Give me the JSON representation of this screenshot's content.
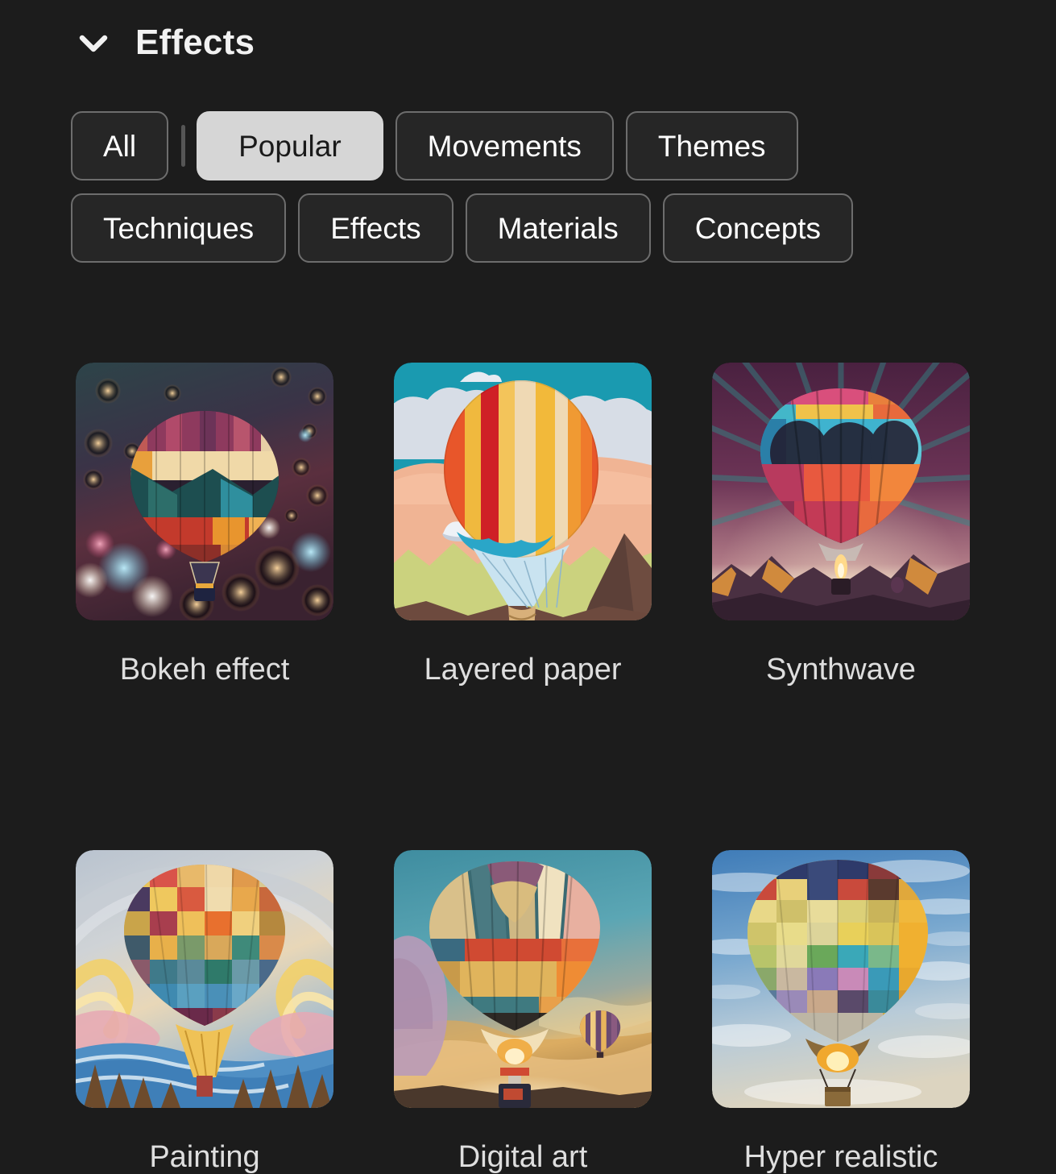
{
  "header": {
    "title": "Effects",
    "collapse_icon": "chevron-down-icon"
  },
  "filters": {
    "rows": [
      [
        {
          "label": "All",
          "selected": false
        },
        {
          "label": "Popular",
          "selected": true
        },
        {
          "label": "Movements",
          "selected": false
        },
        {
          "label": "Themes",
          "selected": false
        }
      ],
      [
        {
          "label": "Techniques",
          "selected": false
        },
        {
          "label": "Effects",
          "selected": false
        },
        {
          "label": "Materials",
          "selected": false
        },
        {
          "label": "Concepts",
          "selected": false
        }
      ]
    ]
  },
  "styles": {
    "items": [
      {
        "label": "Bokeh effect",
        "thumbnail": "hot-air-balloon-bokeh"
      },
      {
        "label": "Layered paper",
        "thumbnail": "hot-air-balloon-paper-craft"
      },
      {
        "label": "Synthwave",
        "thumbnail": "hot-air-balloon-synthwave"
      },
      {
        "label": "Painting",
        "thumbnail": "hot-air-balloon-impressionist-painting"
      },
      {
        "label": "Digital art",
        "thumbnail": "hot-air-balloon-digital-art"
      },
      {
        "label": "Hyper realistic",
        "thumbnail": "hot-air-balloon-photograph"
      }
    ]
  },
  "colors": {
    "background": "#1c1c1c",
    "chip_background": "#262626",
    "chip_border": "#6d6d6d",
    "chip_selected_background": "#d6d6d6",
    "chip_selected_text": "#1a1a1a",
    "text": "#e9e9e9"
  }
}
